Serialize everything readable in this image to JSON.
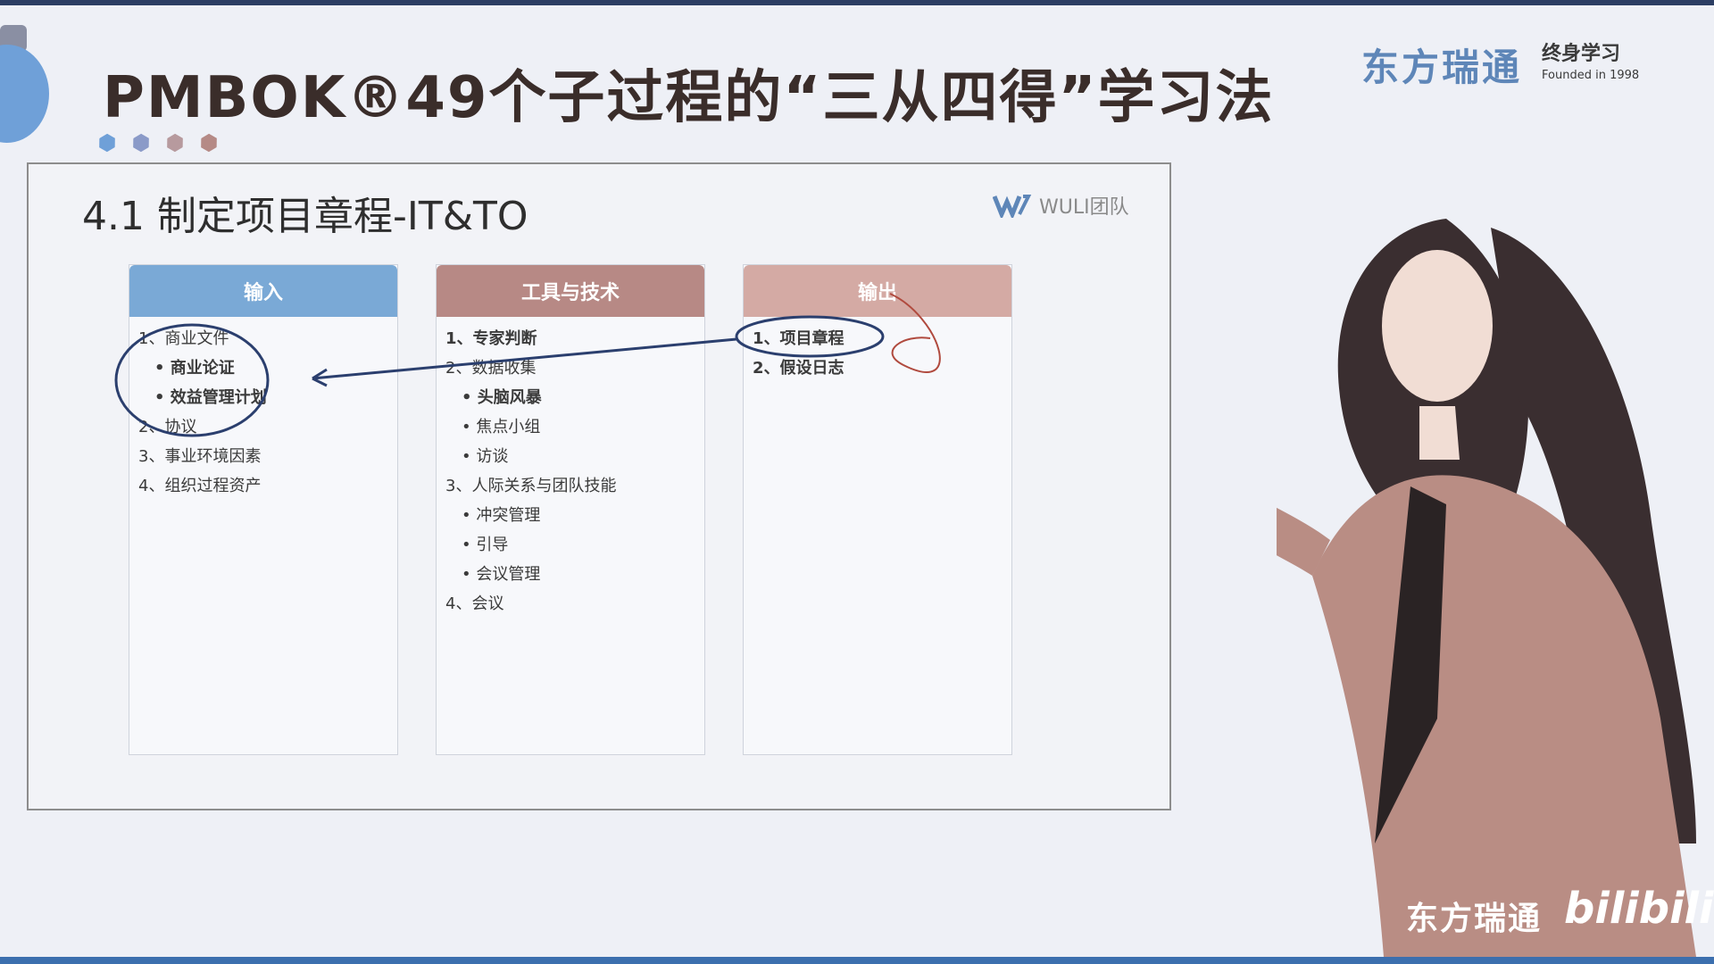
{
  "header": {
    "title": "PMBOK®49个子过程的“三从四得”学习法",
    "dot_colors": [
      "#6fa0d8",
      "#8a9ac8",
      "#b79a9e",
      "#b58a86"
    ]
  },
  "brand": {
    "name": "东方瑞通",
    "sub_title": "终身学习",
    "founded": "Founded in 1998"
  },
  "slide": {
    "title": "4.1 制定项目章程-IT&TO",
    "watermark_logo": "WULI团队",
    "columns": [
      {
        "header": "输入",
        "color": "#7aa9d6",
        "items": [
          {
            "text": "1、商业文件",
            "sub": false,
            "bold": false
          },
          {
            "text": "• 商业论证",
            "sub": true,
            "bold": true
          },
          {
            "text": "• 效益管理计划",
            "sub": true,
            "bold": true
          },
          {
            "text": "2、协议",
            "sub": false,
            "bold": false
          },
          {
            "text": "3、事业环境因素",
            "sub": false,
            "bold": false
          },
          {
            "text": "4、组织过程资产",
            "sub": false,
            "bold": false
          }
        ]
      },
      {
        "header": "工具与技术",
        "color": "#b78985",
        "items": [
          {
            "text": "1、专家判断",
            "sub": false,
            "bold": true
          },
          {
            "text": "2、数据收集",
            "sub": false,
            "bold": false
          },
          {
            "text": "• 头脑风暴",
            "sub": true,
            "bold": true
          },
          {
            "text": "• 焦点小组",
            "sub": true,
            "bold": false
          },
          {
            "text": "• 访谈",
            "sub": true,
            "bold": false
          },
          {
            "text": "3、人际关系与团队技能",
            "sub": false,
            "bold": false
          },
          {
            "text": "• 冲突管理",
            "sub": true,
            "bold": false
          },
          {
            "text": "• 引导",
            "sub": true,
            "bold": false
          },
          {
            "text": "• 会议管理",
            "sub": true,
            "bold": false
          },
          {
            "text": "4、会议",
            "sub": false,
            "bold": false
          }
        ]
      },
      {
        "header": "输出",
        "color": "#d4aaa4",
        "items": [
          {
            "text": "1、项目章程",
            "sub": false,
            "bold": true
          },
          {
            "text": "2、假设日志",
            "sub": false,
            "bold": true
          }
        ]
      }
    ]
  },
  "footer": {
    "brand": "东方瑞通",
    "platform": "bilibili"
  }
}
